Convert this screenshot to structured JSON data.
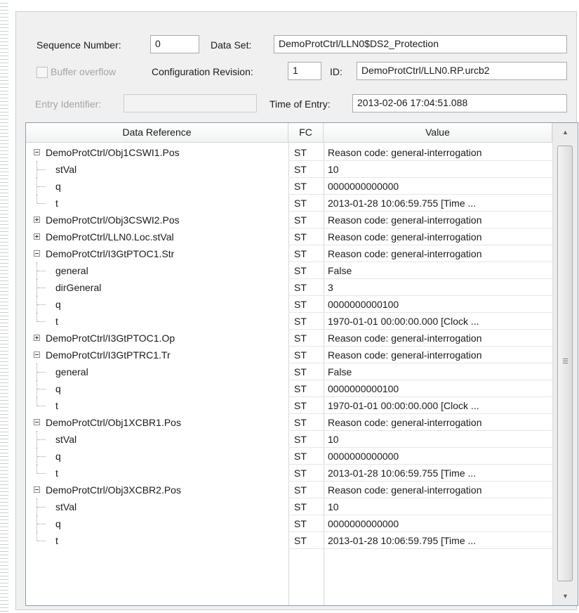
{
  "report": {
    "sequence_number_label": "Sequence Number:",
    "sequence_number_value": "0",
    "data_set_label": "Data Set:",
    "data_set_value": "DemoProtCtrl/LLN0$DS2_Protection",
    "buffer_overflow_label": "Buffer overflow",
    "buffer_overflow_checked": false,
    "config_revision_label": "Configuration Revision:",
    "config_revision_value": "1",
    "id_label": "ID:",
    "id_value": "DemoProtCtrl/LLN0.RP.urcb2",
    "entry_identifier_label": "Entry Identifier:",
    "entry_identifier_value": "",
    "time_of_entry_label": "Time of Entry:",
    "time_of_entry_value": "2013-02-06 17:04:51.088"
  },
  "table": {
    "columns": [
      "Data Reference",
      "FC",
      "Value"
    ],
    "rows": [
      {
        "name": "DemoProtCtrl/Obj1CSWI1.Pos",
        "fc": "ST",
        "value": "Reason code: general-interrogation",
        "level": 0,
        "expander": "minus"
      },
      {
        "name": "stVal",
        "fc": "ST",
        "value": "10",
        "level": 1
      },
      {
        "name": "q",
        "fc": "ST",
        "value": "0000000000000",
        "level": 1
      },
      {
        "name": "t",
        "fc": "ST",
        "value": "2013-01-28 10:06:59.755 [Time ...",
        "level": 1,
        "last": true
      },
      {
        "name": "DemoProtCtrl/Obj3CSWI2.Pos",
        "fc": "ST",
        "value": "Reason code: general-interrogation",
        "level": 0,
        "expander": "plus"
      },
      {
        "name": "DemoProtCtrl/LLN0.Loc.stVal",
        "fc": "ST",
        "value": "Reason code: general-interrogation",
        "level": 0,
        "expander": "plus"
      },
      {
        "name": "DemoProtCtrl/I3GtPTOC1.Str",
        "fc": "ST",
        "value": "Reason code: general-interrogation",
        "level": 0,
        "expander": "minus"
      },
      {
        "name": "general",
        "fc": "ST",
        "value": "False",
        "level": 1
      },
      {
        "name": "dirGeneral",
        "fc": "ST",
        "value": "3",
        "level": 1
      },
      {
        "name": "q",
        "fc": "ST",
        "value": "0000000000100",
        "level": 1
      },
      {
        "name": "t",
        "fc": "ST",
        "value": "1970-01-01 00:00:00.000 [Clock ...",
        "level": 1,
        "last": true
      },
      {
        "name": "DemoProtCtrl/I3GtPTOC1.Op",
        "fc": "ST",
        "value": "Reason code: general-interrogation",
        "level": 0,
        "expander": "plus"
      },
      {
        "name": "DemoProtCtrl/I3GtPTRC1.Tr",
        "fc": "ST",
        "value": "Reason code: general-interrogation",
        "level": 0,
        "expander": "minus"
      },
      {
        "name": "general",
        "fc": "ST",
        "value": "False",
        "level": 1
      },
      {
        "name": "q",
        "fc": "ST",
        "value": "0000000000100",
        "level": 1
      },
      {
        "name": "t",
        "fc": "ST",
        "value": "1970-01-01 00:00:00.000 [Clock ...",
        "level": 1,
        "last": true
      },
      {
        "name": "DemoProtCtrl/Obj1XCBR1.Pos",
        "fc": "ST",
        "value": "Reason code: general-interrogation",
        "level": 0,
        "expander": "minus"
      },
      {
        "name": "stVal",
        "fc": "ST",
        "value": "10",
        "level": 1
      },
      {
        "name": "q",
        "fc": "ST",
        "value": "0000000000000",
        "level": 1
      },
      {
        "name": "t",
        "fc": "ST",
        "value": "2013-01-28 10:06:59.755 [Time ...",
        "level": 1,
        "last": true
      },
      {
        "name": "DemoProtCtrl/Obj3XCBR2.Pos",
        "fc": "ST",
        "value": "Reason code: general-interrogation",
        "level": 0,
        "expander": "minus"
      },
      {
        "name": "stVal",
        "fc": "ST",
        "value": "10",
        "level": 1
      },
      {
        "name": "q",
        "fc": "ST",
        "value": "0000000000000",
        "level": 1
      },
      {
        "name": "t",
        "fc": "ST",
        "value": "2013-01-28 10:06:59.795 [Time ...",
        "level": 1,
        "last": true
      }
    ]
  },
  "scrollbar": {
    "up_icon": "scroll-up-arrow-icon",
    "down_icon": "scroll-down-arrow-icon"
  }
}
